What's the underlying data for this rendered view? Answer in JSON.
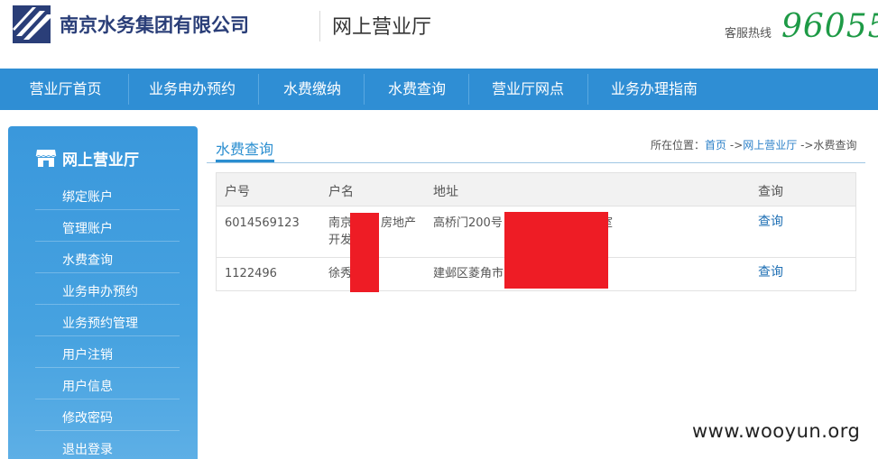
{
  "header": {
    "company_name": "南京水务集团有限公司",
    "site_title": "网上营业厅",
    "hotline_label": "客服热线",
    "hotline_number": "96055",
    "brand_color": "#2a3e78",
    "hotline_color": "#1e9a46"
  },
  "nav": {
    "items": [
      {
        "label": "营业厅首页"
      },
      {
        "label": "业务申办预约"
      },
      {
        "label": "水费缴纳"
      },
      {
        "label": "水费查询"
      },
      {
        "label": "营业厅网点"
      },
      {
        "label": "业务办理指南"
      }
    ],
    "color": "#2f8ed4"
  },
  "sidebar": {
    "title": "网上营业厅",
    "icon": "store-icon",
    "items": [
      {
        "label": "绑定账户"
      },
      {
        "label": "管理账户"
      },
      {
        "label": "水费查询"
      },
      {
        "label": "业务申办预约"
      },
      {
        "label": "业务预约管理"
      },
      {
        "label": "用户注销"
      },
      {
        "label": "用户信息"
      },
      {
        "label": "修改密码"
      },
      {
        "label": "退出登录"
      }
    ]
  },
  "main": {
    "title": "水费查询",
    "breadcrumb": {
      "label": "所在位置：",
      "home": "首页",
      "sep1": "->",
      "level1": "网上营业厅",
      "sep2": "->",
      "current": "水费查询"
    },
    "table": {
      "headers": [
        "户号",
        "户名",
        "地址",
        "查询"
      ],
      "rows": [
        {
          "account": "6014569123",
          "name_line1": "南京",
          "name_line1b": "房地产",
          "name_line2": "开发",
          "address": "高桥门200号",
          "address_tail": "室",
          "action": "查询"
        },
        {
          "account": "1122496",
          "name_line1": "徐秀",
          "name_line1b": "",
          "name_line2": "",
          "address": "建邺区菱角市",
          "address_tail": "",
          "action": "查询"
        }
      ]
    }
  },
  "watermark": "www.wooyun.org",
  "redaction_color": "#ee1c25"
}
